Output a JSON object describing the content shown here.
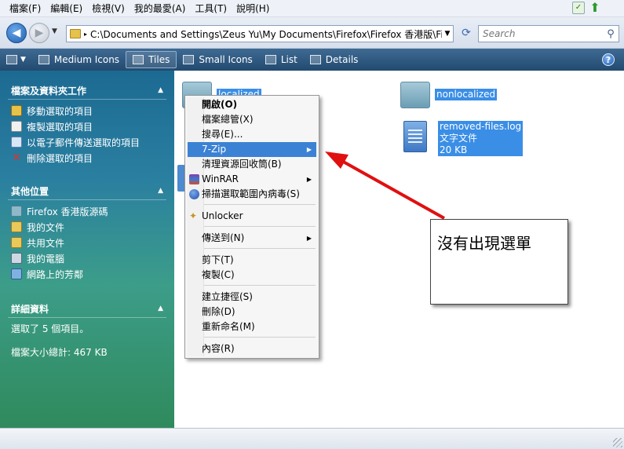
{
  "menubar": {
    "items": [
      "檔案(F)",
      "編輯(E)",
      "檢視(V)",
      "我的最愛(A)",
      "工具(T)",
      "說明(H)"
    ]
  },
  "address": {
    "path": "C:\\Documents and Settings\\Zeus Yu\\My Documents\\Firefox\\Firefox 香港版\\Firefox 桌..."
  },
  "search": {
    "placeholder": "Search"
  },
  "toolbar": {
    "items": [
      "Medium Icons",
      "Tiles",
      "Small Icons",
      "List",
      "Details"
    ],
    "active": "Tiles"
  },
  "left_pane": {
    "tasks_title": "檔案及資料夾工作",
    "tasks": [
      "移動選取的項目",
      "複製選取的項目",
      "以電子郵件傳送選取的項目",
      "刪除選取的項目"
    ],
    "places_title": "其他位置",
    "places": [
      "Firefox 香港版源碼",
      "我的文件",
      "共用文件",
      "我的電腦",
      "網路上的芳鄰"
    ],
    "details_title": "詳細資料",
    "details": [
      "選取了 5 個項目。",
      "檔案大小總計: 467 KB"
    ]
  },
  "files": {
    "f1": {
      "name": "localized"
    },
    "f2": {
      "name": "nonlocalized"
    },
    "f3": {
      "name": "removed-files.log",
      "type": "文字文件",
      "size": "20 KB"
    }
  },
  "context_menu": {
    "open": "開啟(O)",
    "explorer": "檔案總管(X)",
    "search": "搜尋(E)...",
    "sevenzip": "7-Zip",
    "recycle": "清理資源回收筒(B)",
    "winrar": "WinRAR",
    "scan": "掃描選取範圍內病毒(S)",
    "unlocker": "Unlocker",
    "sendto": "傳送到(N)",
    "cut": "剪下(T)",
    "copy": "複製(C)",
    "shortcut": "建立捷徑(S)",
    "delete": "刪除(D)",
    "rename": "重新命名(M)",
    "properties": "內容(R)"
  },
  "annotation": {
    "text": "沒有出現選單"
  },
  "colors": {
    "highlight": "#3c82d4",
    "arrow": "#e01010"
  }
}
